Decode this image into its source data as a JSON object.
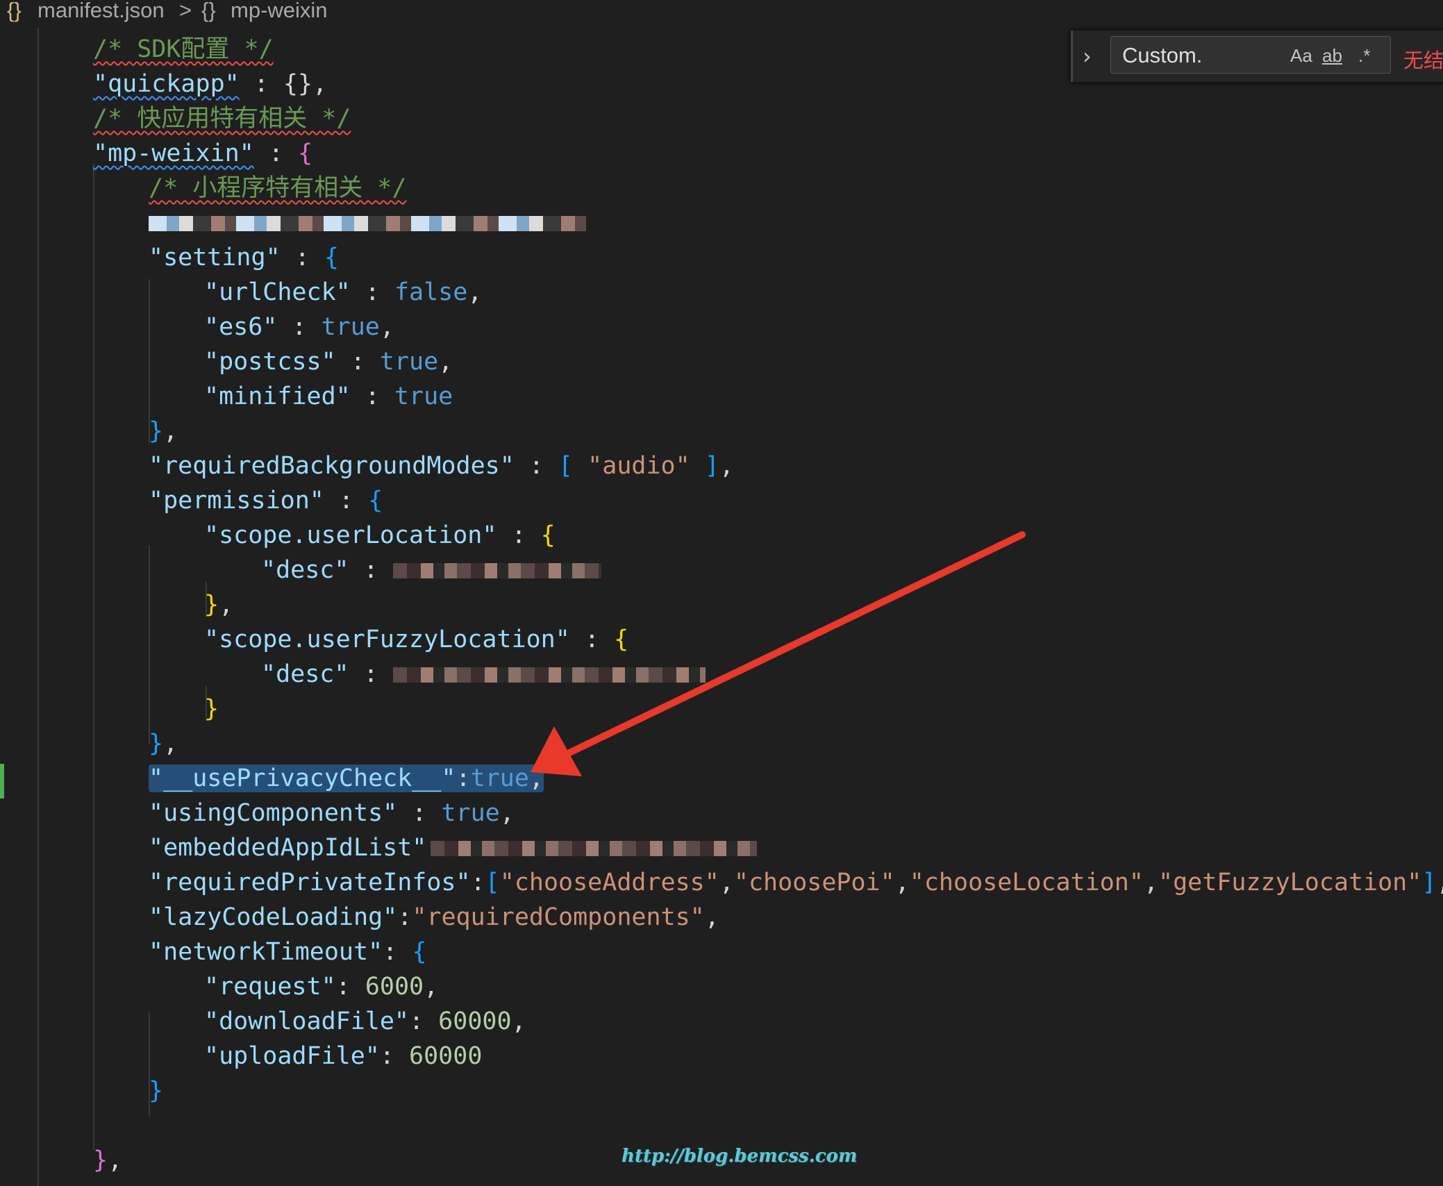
{
  "breadcrumb": {
    "file_icon": "{}",
    "file": "manifest.json",
    "separator": ">",
    "symbol_icon": "{}",
    "symbol": "mp-weixin"
  },
  "find_widget": {
    "value": "Custom.",
    "match_case": "Aa",
    "whole_word": "ab",
    "regex": ".*",
    "result": "无结果"
  },
  "code": {
    "l1": "/* SDK配置 */",
    "l2_key": "\"quickapp\"",
    "l2_rest": " : {},",
    "l3": "/* 快应用特有相关 */",
    "l4_key": "\"mp-weixin\"",
    "l4_rest": " : {",
    "l5": "/* 小程序特有相关 */",
    "l7_key": "\"setting\"",
    "l8_key": "\"urlCheck\"",
    "l8_val": "false",
    "l9_key": "\"es6\"",
    "l9_val": "true",
    "l10_key": "\"postcss\"",
    "l10_val": "true",
    "l11_key": "\"minified\"",
    "l11_val": "true",
    "l13_key": "\"requiredBackgroundModes\"",
    "l13_val": "\"audio\"",
    "l14_key": "\"permission\"",
    "l15_key": "\"scope.userLocation\"",
    "l16_key": "\"desc\"",
    "l18_key": "\"scope.userFuzzyLocation\"",
    "l19_key": "\"desc\"",
    "l22_key": "\"__usePrivacyCheck__\"",
    "l22_val": "true",
    "l23_key": "\"usingComponents\"",
    "l23_val": "true",
    "l24_key": "\"embeddedAppIdList\"",
    "l25_key": "\"requiredPrivateInfos\"",
    "l25_v1": "\"chooseAddress\"",
    "l25_v2": "\"choosePoi\"",
    "l25_v3": "\"chooseLocation\"",
    "l25_v4": "\"getFuzzyLocation\"",
    "l26_key": "\"lazyCodeLoading\"",
    "l26_val": "\"requiredComponents\"",
    "l27_key": "\"networkTimeout\"",
    "l28_key": "\"request\"",
    "l28_val": "6000",
    "l29_key": "\"downloadFile\"",
    "l29_val": "60000",
    "l30_key": "\"uploadFile\"",
    "l30_val": "60000"
  },
  "watermark": "http://blog.bemcss.com",
  "colors": {
    "arrow": "#e8392a",
    "selection": "#264f78"
  }
}
